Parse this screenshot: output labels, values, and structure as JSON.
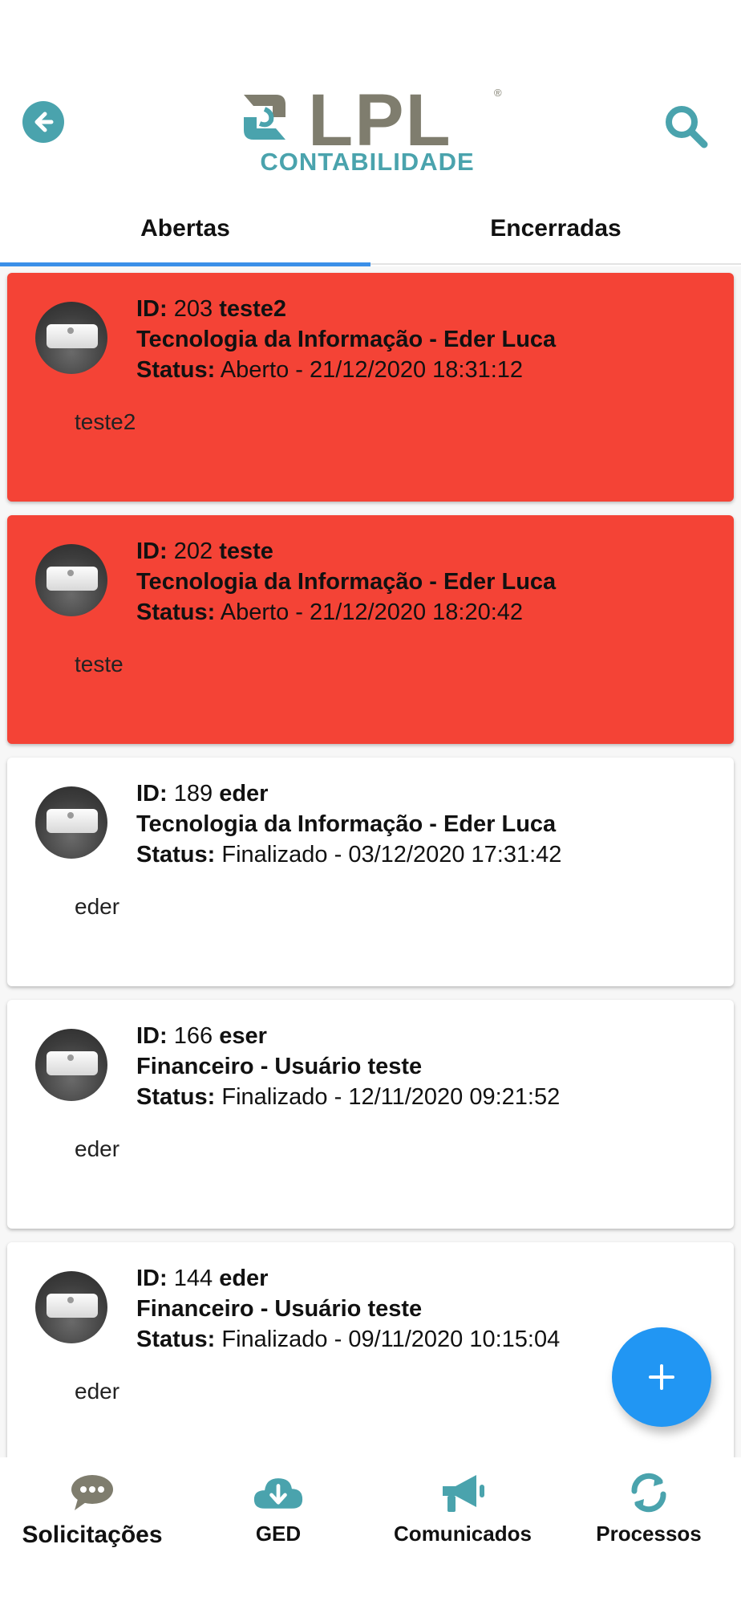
{
  "header": {
    "logo_main": "LPL",
    "logo_sub": "CONTABILIDADE",
    "logo_reg": "®"
  },
  "tabs": [
    {
      "label": "Abertas",
      "active": true
    },
    {
      "label": "Encerradas",
      "active": false
    }
  ],
  "cards": [
    {
      "id_label": "ID:",
      "id": "203",
      "title": "teste2",
      "dept": "Tecnologia da Informação - Eder Luca",
      "status_label": "Status:",
      "status": "Aberto - 21/12/2020 18:31:12",
      "description": "teste2",
      "open": true
    },
    {
      "id_label": "ID:",
      "id": "202",
      "title": "teste",
      "dept": "Tecnologia da Informação - Eder Luca",
      "status_label": "Status:",
      "status": "Aberto - 21/12/2020 18:20:42",
      "description": "teste",
      "open": true
    },
    {
      "id_label": "ID:",
      "id": "189",
      "title": "eder",
      "dept": "Tecnologia da Informação - Eder Luca",
      "status_label": "Status:",
      "status": "Finalizado - 03/12/2020 17:31:42",
      "description": "eder",
      "open": false
    },
    {
      "id_label": "ID:",
      "id": "166",
      "title": "eser",
      "dept": "Financeiro - Usuário teste",
      "status_label": "Status:",
      "status": "Finalizado - 12/11/2020 09:21:52",
      "description": "eder",
      "open": false
    },
    {
      "id_label": "ID:",
      "id": "144",
      "title": "eder",
      "dept": "Financeiro - Usuário teste",
      "status_label": "Status:",
      "status": "Finalizado - 09/11/2020 10:15:04",
      "description": "eder",
      "open": false
    }
  ],
  "fab": {
    "icon": "plus-icon"
  },
  "bottom_nav": [
    {
      "label": "Solicitações",
      "icon": "chat-bubble-icon",
      "active": true
    },
    {
      "label": "GED",
      "icon": "cloud-download-icon",
      "active": false
    },
    {
      "label": "Comunicados",
      "icon": "megaphone-icon",
      "active": false
    },
    {
      "label": "Processos",
      "icon": "sync-icon",
      "active": false
    }
  ],
  "colors": {
    "accent_teal": "#4aa3ad",
    "open_card": "#f44336",
    "fab_blue": "#2196f3",
    "tab_indicator": "#3a8fe8",
    "logo_gray": "#7f7d6e"
  }
}
